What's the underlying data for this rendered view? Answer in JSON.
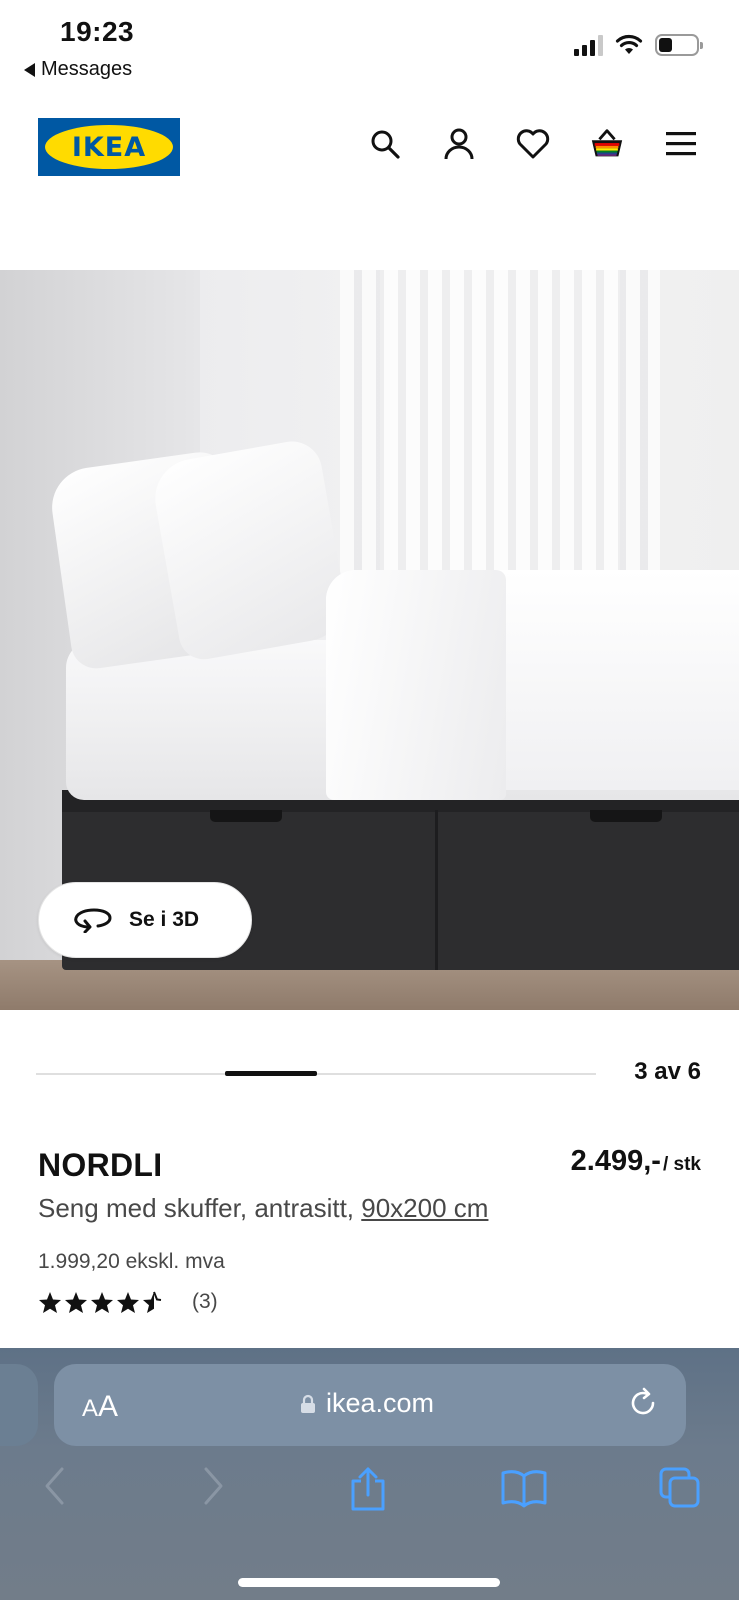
{
  "status_bar": {
    "time": "19:23",
    "back_label": "Messages",
    "icons": [
      "signal-icon",
      "wifi-icon",
      "battery-icon"
    ]
  },
  "header": {
    "logo_text": "IKEA",
    "icons": [
      "search-icon",
      "account-icon",
      "heart-icon",
      "cart-icon",
      "menu-icon"
    ],
    "colors": {
      "brand_blue": "#0058a3",
      "brand_yellow": "#ffdb00"
    }
  },
  "media": {
    "see_3d_label": "Se i 3D",
    "counter": "3 av 6",
    "current_index": 3,
    "total": 6
  },
  "product": {
    "name": "NORDLI",
    "price": "2.499,-",
    "price_unit": "/ stk",
    "description_prefix": "Seng med skuffer, antrasitt,",
    "size_link": "90x200 cm",
    "price_excl_vat": "1.999,20 ekskl. mva",
    "rating": 4.5,
    "rating_max": 5,
    "rating_count": "(3)"
  },
  "browser": {
    "text_size_label_small": "A",
    "text_size_label_large": "A",
    "url": "ikea.com",
    "toolbar_icons": [
      "back-icon",
      "forward-icon",
      "share-icon",
      "bookmarks-icon",
      "tabs-icon"
    ]
  }
}
